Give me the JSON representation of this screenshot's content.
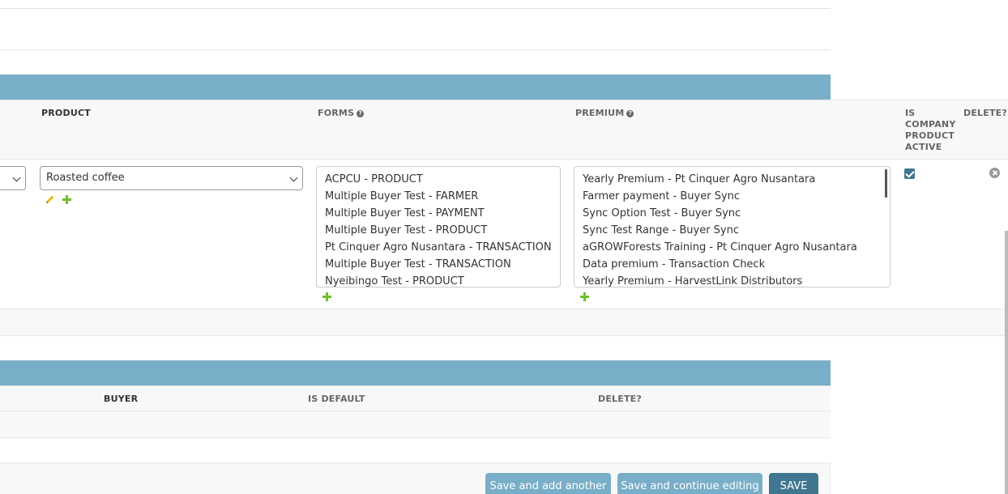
{
  "product_inline": {
    "headers": {
      "product": "PRODUCT",
      "forms": "FORMS",
      "premium": "PREMIUM",
      "is_company_product_active": [
        "IS",
        "COMPANY",
        "PRODUCT",
        "ACTIVE"
      ],
      "delete": "DELETE?"
    },
    "help_icon": "question-circle-icon",
    "row": {
      "product_selected": "Roasted coffee",
      "forms_options": [
        "ACPCU - PRODUCT",
        "Multiple Buyer Test - FARMER",
        "Multiple Buyer Test - PAYMENT",
        "Multiple Buyer Test - PRODUCT",
        "Pt Cinquer Agro Nusantara - TRANSACTION",
        "Multiple Buyer Test - TRANSACTION",
        "Nyeibingo Test - PRODUCT"
      ],
      "premium_options": [
        "Yearly Premium - Pt Cinquer Agro Nusantara",
        "Farmer payment - Buyer Sync",
        "Sync Option Test - Buyer Sync",
        "Sync Test Range - Buyer Sync",
        "aGROWForests Training - Pt Cinquer Agro Nusantara",
        "Data premium - Transaction Check",
        "Yearly Premium - HarvestLink Distributors"
      ],
      "is_active": true
    }
  },
  "buyer_inline": {
    "headers": {
      "buyer": "BUYER",
      "is_default": "IS DEFAULT",
      "delete": "DELETE?"
    }
  },
  "submit_row": {
    "save_add_another": "Save and add another",
    "save_continue": "Save and continue editing",
    "save": "SAVE"
  },
  "colors": {
    "band": "#79aec8",
    "primary_button": "#417690",
    "add_green": "#70bf2b",
    "edit_yellow": "#efb80b"
  }
}
